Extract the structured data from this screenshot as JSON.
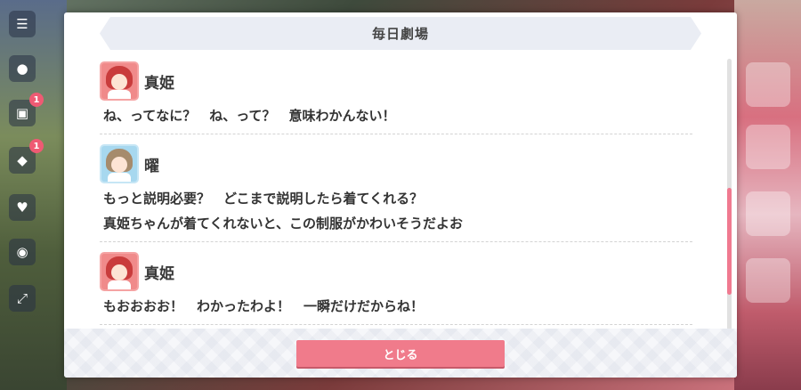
{
  "dialog": {
    "title": "毎日劇場",
    "close_label": "とじる"
  },
  "entries": [
    {
      "speaker": "真姫",
      "avatar": "maki-avatar",
      "lines": [
        "ね、ってなに？　ね、って？　意味わかんない！"
      ]
    },
    {
      "speaker": "曜",
      "avatar": "you-avatar",
      "lines": [
        "もっと説明必要？　どこまで説明したら着てくれる？",
        "真姫ちゃんが着てくれないと、この制服がかわいそうだよお"
      ]
    },
    {
      "speaker": "真姫",
      "avatar": "maki-avatar",
      "lines": [
        "もおおおお！　わかったわよ！　一瞬だけだからね！"
      ]
    }
  ],
  "background": {
    "badges": [
      "1",
      "1"
    ]
  },
  "colors": {
    "accent": "#f07b8b",
    "scroll_thumb": "#f07a90",
    "title_bar": "#eaedf4"
  }
}
